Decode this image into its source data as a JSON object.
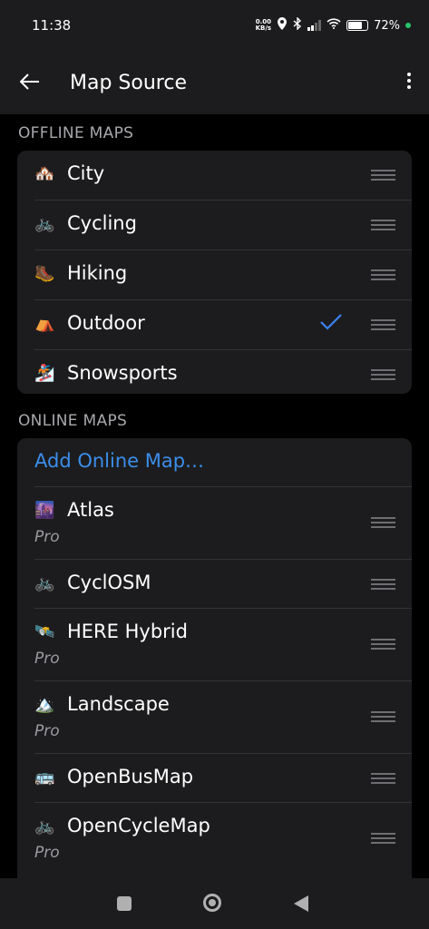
{
  "status": {
    "time": "11:38",
    "net_speed_value": "0.00",
    "net_speed_unit": "KB/s",
    "battery": "72%"
  },
  "appbar": {
    "title": "Map Source"
  },
  "offline": {
    "header": "OFFLINE MAPS",
    "items": [
      {
        "icon": "🏘️",
        "label": "City"
      },
      {
        "icon": "🚲",
        "label": "Cycling"
      },
      {
        "icon": "🥾",
        "label": "Hiking"
      },
      {
        "icon": "⛺",
        "label": "Outdoor",
        "selected": true
      },
      {
        "icon": "🏂",
        "label": "Snowsports"
      }
    ]
  },
  "online": {
    "header": "ONLINE MAPS",
    "add_label": "Add Online Map…",
    "items": [
      {
        "icon": "🌆",
        "label": "Atlas",
        "sub": "Pro"
      },
      {
        "icon": "🚲",
        "label": "CyclOSM"
      },
      {
        "icon": "🛰️",
        "label": "HERE Hybrid",
        "sub": "Pro"
      },
      {
        "icon": "🏔️",
        "label": "Landscape",
        "sub": "Pro"
      },
      {
        "icon": "🚌",
        "label": "OpenBusMap"
      },
      {
        "icon": "🚲",
        "label": "OpenCycleMap",
        "sub": "Pro"
      }
    ]
  },
  "accent_color": "#3b8eea"
}
